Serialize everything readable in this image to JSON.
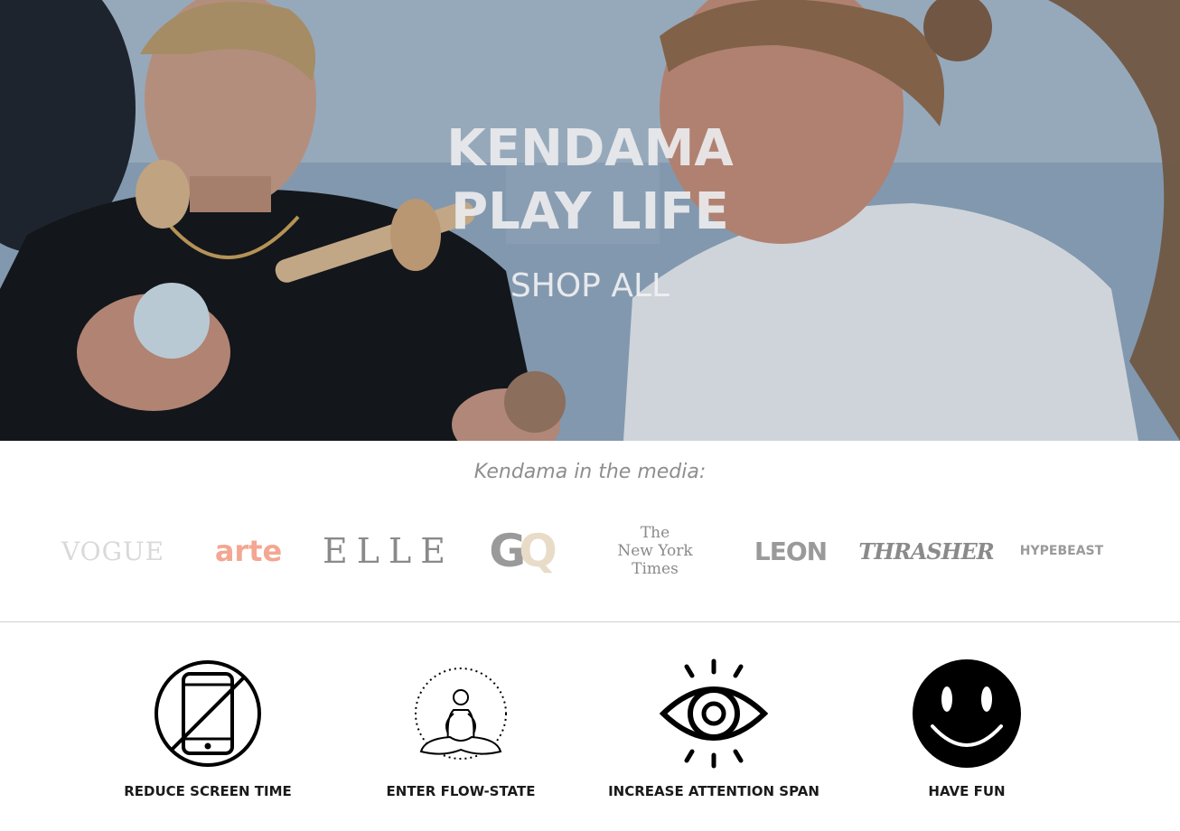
{
  "hero": {
    "title_line1": "KENDAMA",
    "title_line2": "PLAY LIFE",
    "cta_label": "SHOP ALL"
  },
  "media": {
    "heading": "Kendama in the media:",
    "logos": [
      {
        "name": "VOGUE",
        "color": "#d9d9d9"
      },
      {
        "name": "arte",
        "color": "#f3a792"
      },
      {
        "name": "ELLE",
        "color": "#8a8a8a"
      },
      {
        "name": "GQ",
        "color": "#9a9a9a"
      },
      {
        "name": "The New York Times",
        "color": "#8a8a8a"
      },
      {
        "name": "LEON",
        "color": "#9a9a9a"
      },
      {
        "name": "THRASHER",
        "color": "#8a8a8a"
      },
      {
        "name": "HYPEBEAST",
        "color": "#9a9a9a"
      }
    ],
    "nyt_lines": [
      "The",
      "New York",
      "Times"
    ],
    "gq_letters": [
      "G",
      "Q"
    ]
  },
  "benefits": [
    {
      "label": "REDUCE SCREEN TIME",
      "icon": "no-phone-icon"
    },
    {
      "label": "ENTER FLOW-STATE",
      "icon": "meditation-icon"
    },
    {
      "label": "INCREASE ATTENTION SPAN",
      "icon": "eye-icon"
    },
    {
      "label": "HAVE FUN",
      "icon": "smiley-face-icon"
    }
  ]
}
